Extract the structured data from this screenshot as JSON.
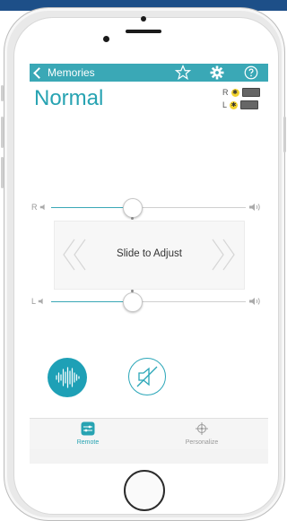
{
  "nav": {
    "back_label": "Memories",
    "icons": [
      "star-icon",
      "gear-icon",
      "help-icon"
    ]
  },
  "program": {
    "title": "Normal"
  },
  "hearing_aids": {
    "right": {
      "label": "R",
      "bluetooth_icon": "bluetooth-icon"
    },
    "left": {
      "label": "L",
      "bluetooth_icon": "bluetooth-icon"
    }
  },
  "volume": {
    "right": {
      "label": "R",
      "level": 0.38
    },
    "left": {
      "label": "L",
      "level": 0.38
    }
  },
  "adjust": {
    "label": "Slide to Adjust"
  },
  "tabs": [
    {
      "label": "Remote",
      "icon": "remote-icon",
      "active": true
    },
    {
      "label": "Personalize",
      "icon": "crosshair-icon",
      "active": false
    }
  ],
  "colors": {
    "accent": "#27a3b2",
    "navbar": "#3aa8b6",
    "top_band": "#1d4f88"
  }
}
